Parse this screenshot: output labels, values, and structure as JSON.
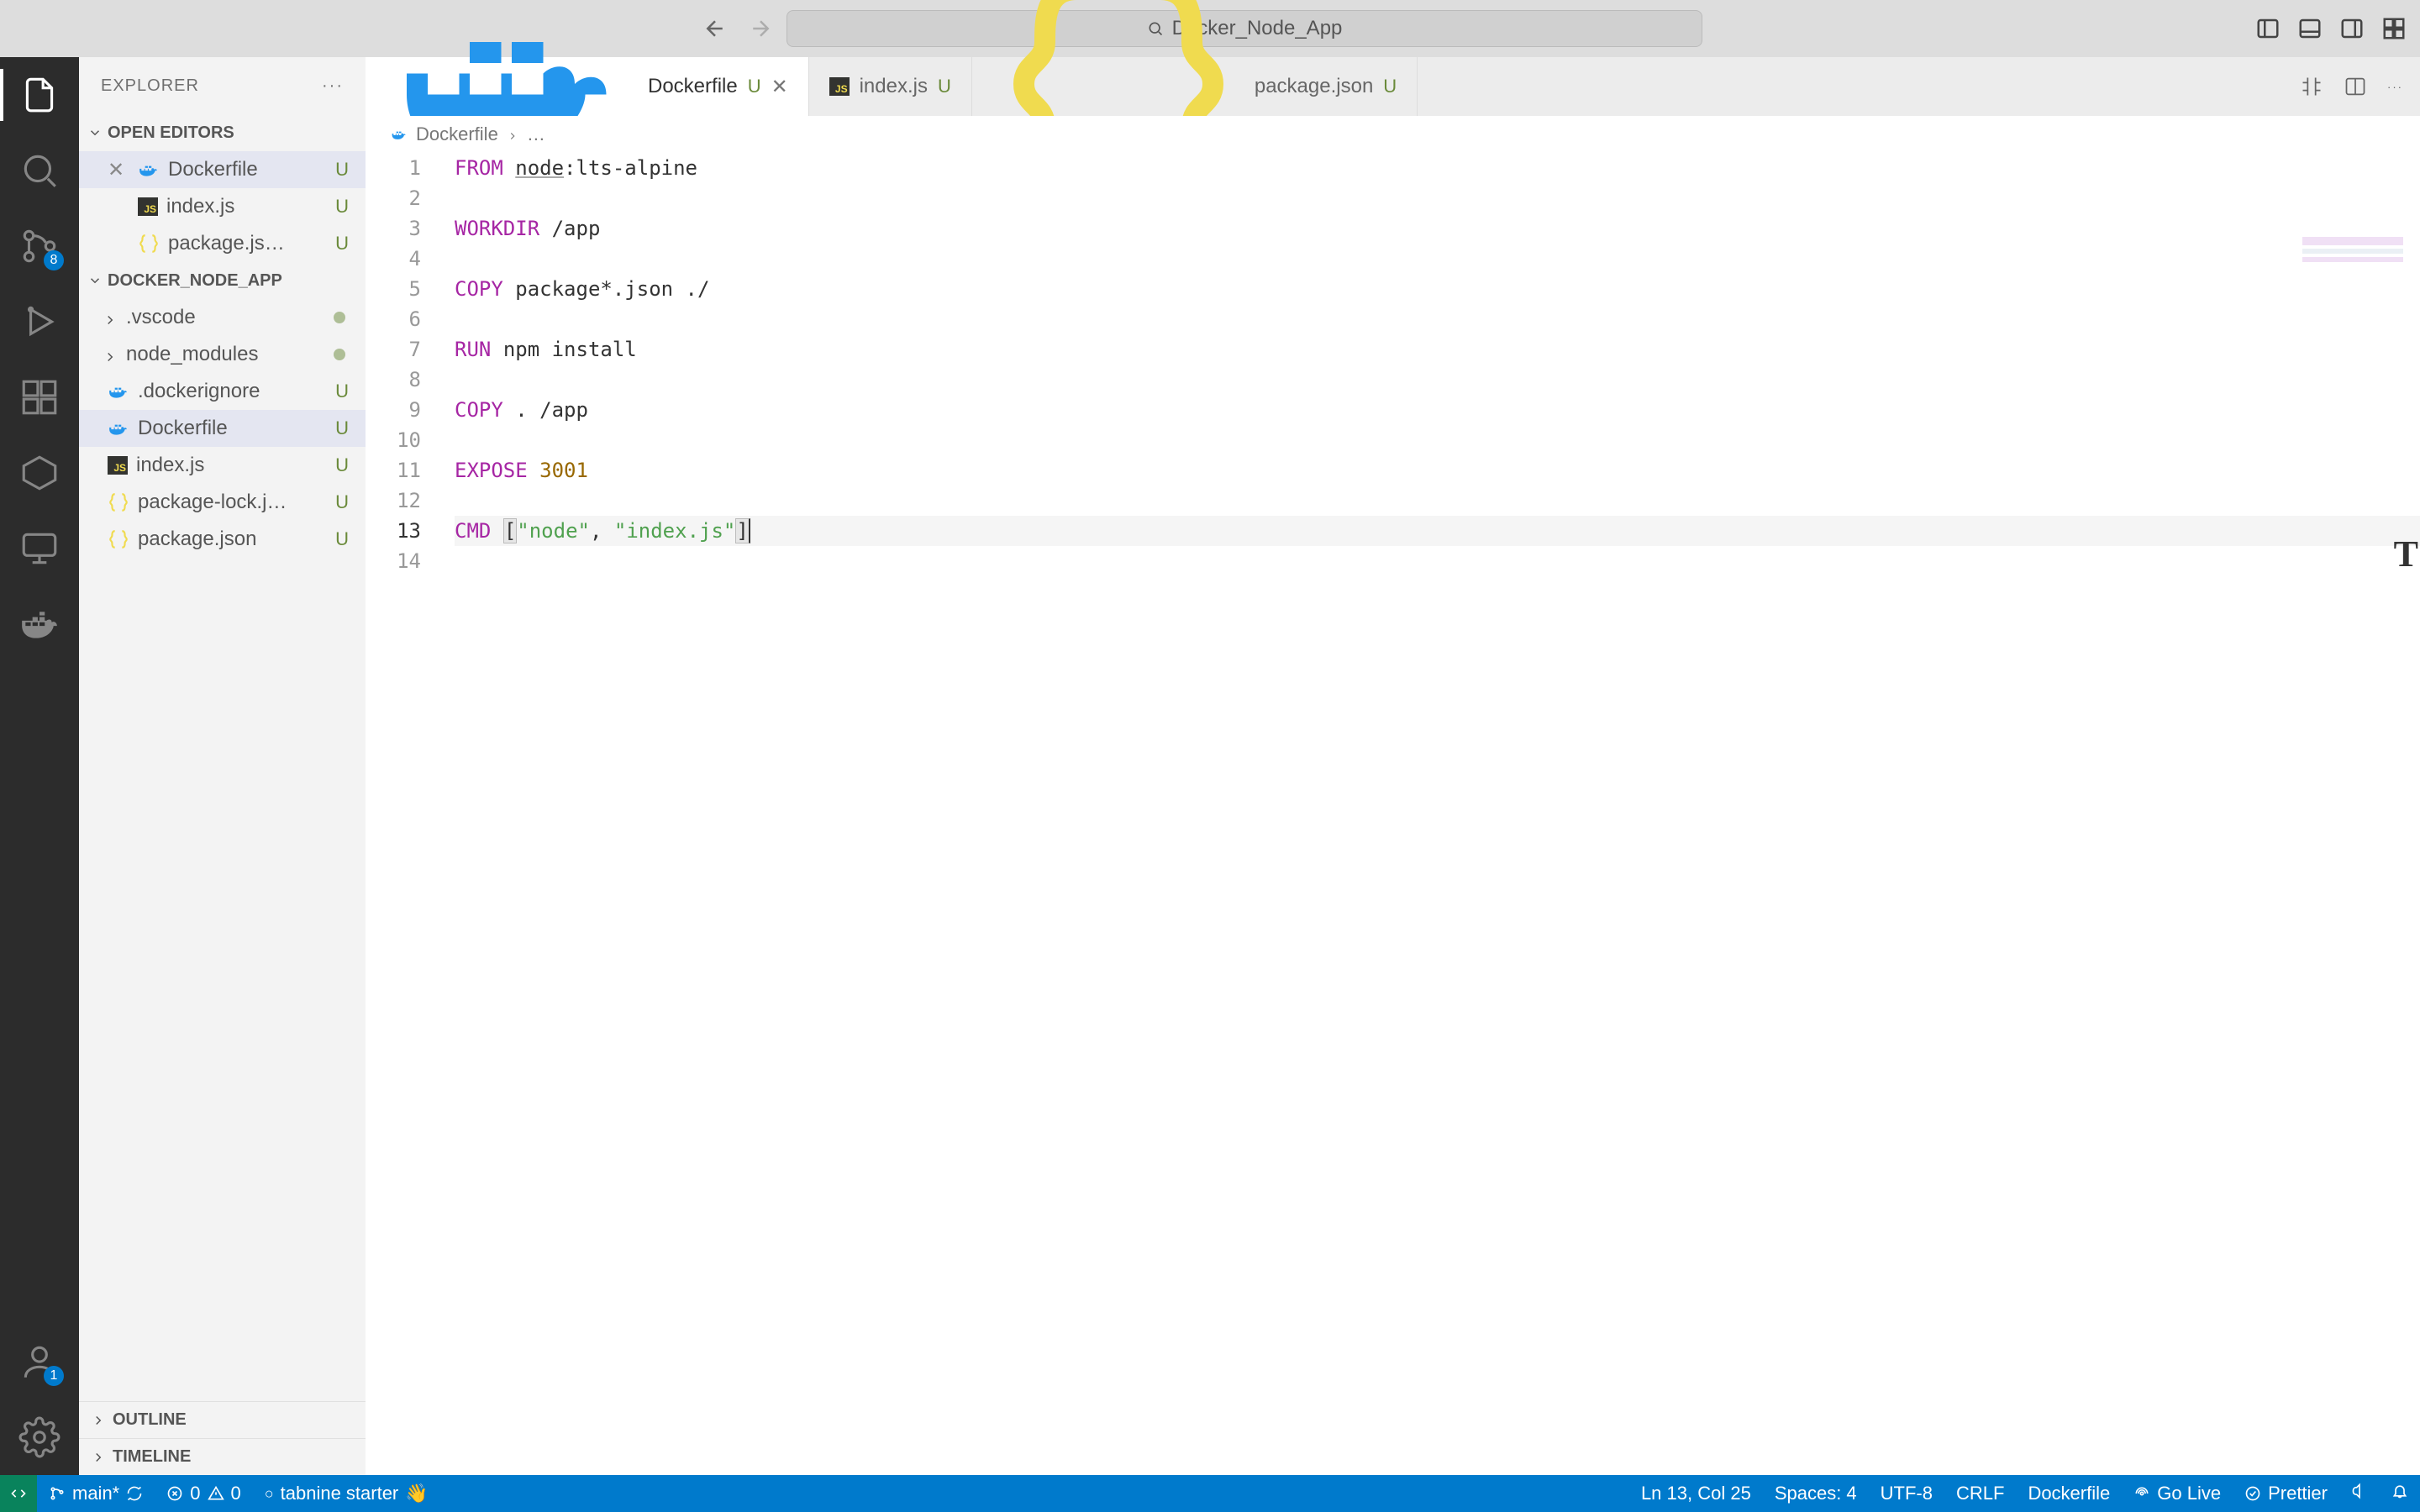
{
  "title_bar": {
    "search_text": "Docker_Node_App"
  },
  "activity": {
    "scm_badge": "8",
    "accounts_badge": "1"
  },
  "sidebar": {
    "title": "EXPLORER",
    "sections": {
      "open_editors": {
        "label": "OPEN EDITORS",
        "items": [
          {
            "name": "Dockerfile",
            "badge": "U",
            "icon": "docker"
          },
          {
            "name": "index.js",
            "badge": "U",
            "icon": "js"
          },
          {
            "name": "package.js…",
            "badge": "U",
            "icon": "json"
          }
        ]
      },
      "project": {
        "label": "DOCKER_NODE_APP",
        "items": [
          {
            "name": ".vscode",
            "type": "folder",
            "status": "dot"
          },
          {
            "name": "node_modules",
            "type": "folder",
            "status": "dot"
          },
          {
            "name": ".dockerignore",
            "icon": "docker",
            "badge": "U"
          },
          {
            "name": "Dockerfile",
            "icon": "docker",
            "badge": "U",
            "active": true
          },
          {
            "name": "index.js",
            "icon": "js",
            "badge": "U"
          },
          {
            "name": "package-lock.j…",
            "icon": "json",
            "badge": "U"
          },
          {
            "name": "package.json",
            "icon": "json",
            "badge": "U"
          }
        ]
      },
      "outline": "OUTLINE",
      "timeline": "TIMELINE"
    }
  },
  "tabs": [
    {
      "name": "Dockerfile",
      "mod": "U",
      "active": true,
      "icon": "docker",
      "close": true
    },
    {
      "name": "index.js",
      "mod": "U",
      "icon": "js"
    },
    {
      "name": "package.json",
      "mod": "U",
      "icon": "json"
    }
  ],
  "breadcrumb": {
    "file": "Dockerfile",
    "more": "…"
  },
  "editor": {
    "lines": [
      {
        "n": 1,
        "segs": [
          [
            "kw",
            "FROM"
          ],
          [
            "sp",
            " "
          ],
          [
            "ident under",
            "node"
          ],
          [
            "ident",
            ":lts-alpine"
          ]
        ]
      },
      {
        "n": 2,
        "segs": []
      },
      {
        "n": 3,
        "segs": [
          [
            "kw",
            "WORKDIR"
          ],
          [
            "sp",
            " "
          ],
          [
            "ident",
            "/app"
          ]
        ]
      },
      {
        "n": 4,
        "segs": []
      },
      {
        "n": 5,
        "segs": [
          [
            "kw",
            "COPY"
          ],
          [
            "sp",
            " "
          ],
          [
            "ident",
            "package*.json ./"
          ]
        ]
      },
      {
        "n": 6,
        "segs": []
      },
      {
        "n": 7,
        "segs": [
          [
            "kw",
            "RUN"
          ],
          [
            "sp",
            " "
          ],
          [
            "ident",
            "npm install"
          ]
        ]
      },
      {
        "n": 8,
        "segs": []
      },
      {
        "n": 9,
        "segs": [
          [
            "kw",
            "COPY"
          ],
          [
            "sp",
            " "
          ],
          [
            "ident",
            ". /app"
          ]
        ]
      },
      {
        "n": 10,
        "segs": []
      },
      {
        "n": 11,
        "segs": [
          [
            "kw",
            "EXPOSE"
          ],
          [
            "sp",
            " "
          ],
          [
            "num",
            "3001"
          ]
        ]
      },
      {
        "n": 12,
        "segs": []
      },
      {
        "n": 13,
        "cur": true,
        "segs": [
          [
            "kw",
            "CMD"
          ],
          [
            "sp",
            " "
          ],
          [
            "bracket",
            "["
          ],
          [
            "str",
            "\"node\""
          ],
          [
            "ident",
            ", "
          ],
          [
            "str",
            "\"index.js\""
          ],
          [
            "bracket cursor",
            "]"
          ]
        ]
      },
      {
        "n": 14,
        "segs": []
      }
    ]
  },
  "status": {
    "branch": "main*",
    "errors": "0",
    "warnings": "0",
    "tabnine": "tabnine starter",
    "cursor": "Ln 13, Col 25",
    "spaces": "Spaces: 4",
    "encoding": "UTF-8",
    "eol": "CRLF",
    "lang": "Dockerfile",
    "golive": "Go Live",
    "prettier": "Prettier"
  }
}
